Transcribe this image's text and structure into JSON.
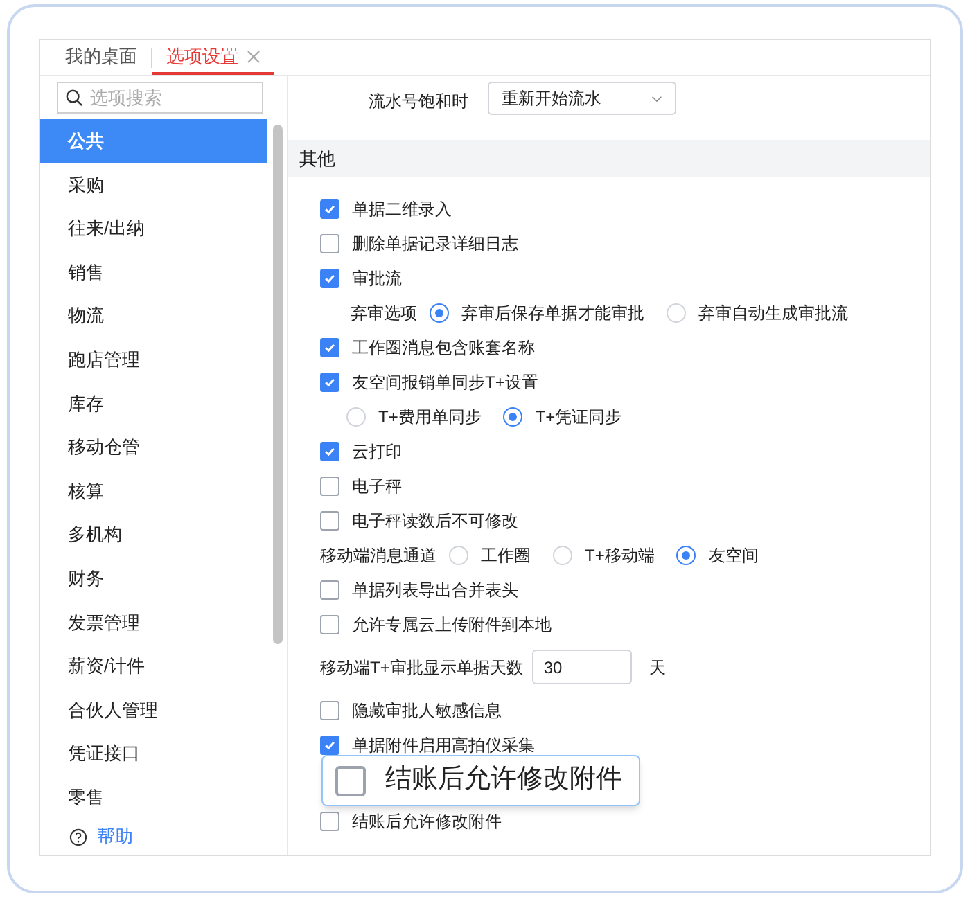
{
  "tabs": [
    {
      "label": "我的桌面",
      "selected": false,
      "closable": false
    },
    {
      "label": "选项设置",
      "selected": true,
      "closable": true
    }
  ],
  "sidebar": {
    "search": {
      "placeholder": "选项搜索"
    },
    "items": [
      {
        "label": "公共",
        "selected": true
      },
      {
        "label": "采购",
        "selected": false
      },
      {
        "label": "往来/出纳",
        "selected": false
      },
      {
        "label": "销售",
        "selected": false
      },
      {
        "label": "物流",
        "selected": false
      },
      {
        "label": "跑店管理",
        "selected": false
      },
      {
        "label": "库存",
        "selected": false
      },
      {
        "label": "移动仓管",
        "selected": false
      },
      {
        "label": "核算",
        "selected": false
      },
      {
        "label": "多机构",
        "selected": false
      },
      {
        "label": "财务",
        "selected": false
      },
      {
        "label": "发票管理",
        "selected": false
      },
      {
        "label": "薪资/计件",
        "selected": false
      },
      {
        "label": "合伙人管理",
        "selected": false
      },
      {
        "label": "凭证接口",
        "selected": false
      },
      {
        "label": "零售",
        "selected": false
      }
    ],
    "help": "帮助"
  },
  "settings": {
    "top_field": {
      "label": "流水号饱和时",
      "value": "重新开始流水"
    },
    "section_title": "其他",
    "rows": [
      {
        "kind": "checkbox",
        "label": "单据二维录入",
        "checked": true
      },
      {
        "kind": "checkbox",
        "label": "删除单据记录详细日志",
        "checked": false
      },
      {
        "kind": "checkbox",
        "label": "审批流",
        "checked": true
      },
      {
        "kind": "radios",
        "label": "弃审选项",
        "options": [
          {
            "label": "弃审后保存单据才能审批",
            "selected": true
          },
          {
            "label": "弃审自动生成审批流",
            "selected": false
          }
        ]
      },
      {
        "kind": "checkbox",
        "label": "工作圈消息包含账套名称",
        "checked": true
      },
      {
        "kind": "checkbox",
        "label": "友空间报销单同步T+设置",
        "checked": true
      },
      {
        "kind": "radios",
        "options": [
          {
            "label": "T+费用单同步",
            "selected": false
          },
          {
            "label": "T+凭证同步",
            "selected": true
          }
        ]
      },
      {
        "kind": "checkbox",
        "label": "云打印",
        "checked": true
      },
      {
        "kind": "checkbox",
        "label": "电子秤",
        "checked": false
      },
      {
        "kind": "checkbox",
        "label": "电子秤读数后不可修改",
        "checked": false
      },
      {
        "kind": "channel",
        "label": "移动端消息通道",
        "options": [
          {
            "label": "工作圈",
            "selected": false
          },
          {
            "label": "T+移动端",
            "selected": false
          },
          {
            "label": "友空间",
            "selected": true
          }
        ]
      },
      {
        "kind": "checkbox",
        "label": "单据列表导出合并表头",
        "checked": false
      },
      {
        "kind": "checkbox",
        "label": "允许专属云上传附件到本地",
        "checked": false
      },
      {
        "kind": "number",
        "label": "移动端T+审批显示单据天数",
        "value": "30",
        "unit": "天"
      },
      {
        "kind": "checkbox",
        "label": "隐藏审批人敏感信息",
        "checked": false
      },
      {
        "kind": "checkbox",
        "label": "单据附件启用高拍仪采集",
        "checked": true
      },
      {
        "kind": "hidden"
      },
      {
        "kind": "checkbox",
        "label": "结账后允许修改附件",
        "checked": false
      }
    ],
    "callout": {
      "label": "结账后允许修改附件",
      "checked": false
    }
  }
}
